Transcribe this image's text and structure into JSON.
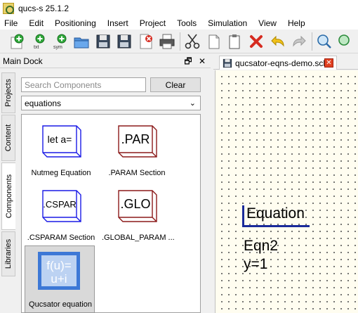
{
  "window": {
    "title": "qucs-s 25.1.2"
  },
  "menu": [
    "File",
    "Edit",
    "Positioning",
    "Insert",
    "Project",
    "Tools",
    "Simulation",
    "View",
    "Help"
  ],
  "toolbar": {
    "new_txt_label": "txt",
    "new_sym_label": "sym"
  },
  "dock": {
    "title": "Main Dock",
    "float_glyph": "🗗",
    "close_glyph": "✕",
    "tabs": [
      "Projects",
      "Content",
      "Components",
      "Libraries"
    ],
    "active_tab": "Components"
  },
  "components_panel": {
    "search_placeholder": "Search Components",
    "clear_label": "Clear",
    "category": "equations",
    "items": [
      {
        "icon_text": "let a=",
        "label": "Nutmeg Equation",
        "color": "#1a1ae6"
      },
      {
        "icon_text": ".PAR",
        "label": ".PARAM Section",
        "color": "#8b1a1a"
      },
      {
        "icon_text": ".CSPAR",
        "label": ".CSPARAM Section",
        "color": "#1a1ae6"
      },
      {
        "icon_text": ".GLO",
        "label": ".GLOBAL_PARAM ...",
        "color": "#8b1a1a"
      },
      {
        "icon_text_1": "f(u)=",
        "icon_text_2": "u+i",
        "label": "Qucsator equation",
        "color": "#3d78d6",
        "selected": true
      }
    ]
  },
  "document": {
    "tab_label": "qucsator-eqns-demo.sch",
    "close_glyph": "✕"
  },
  "schematic": {
    "heading": "Equation",
    "name": "Eqn2",
    "value": "y=1"
  },
  "colors": {
    "accent_blue": "#1a2a9a",
    "canvas_bg": "#fffdf0",
    "close_red": "#e04020"
  }
}
